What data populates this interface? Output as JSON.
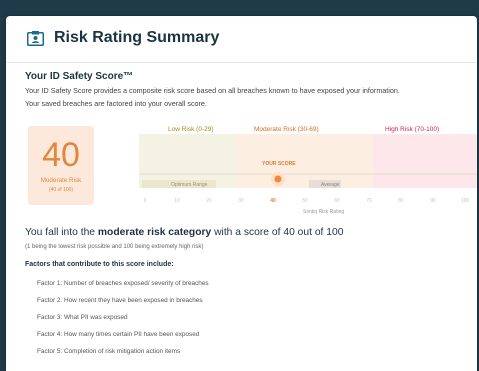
{
  "header": {
    "title": "Risk Rating Summary",
    "icon": "id-card-icon"
  },
  "summary": {
    "heading": "Your ID Safety Score™",
    "description_line1": "Your ID Safety Score provides a composite risk score based on all breaches known to have exposed your information.",
    "description_line2": "Your saved breaches are factored into your overall score."
  },
  "score": {
    "value": "40",
    "label": "Moderate Risk",
    "sublabel": "(40 of 100)"
  },
  "risk_ranges": {
    "low": "Low Risk (0-29)",
    "moderate": "Moderate Risk (30-69)",
    "high": "High Risk (70-100)"
  },
  "gauge": {
    "optimum_label": "Optimum Range",
    "average_label": "Average",
    "your_score_label": "YOUR SCORE",
    "axis_label": "Sontiq Risk Rating",
    "ticks": [
      "0",
      "10",
      "20",
      "30",
      "40",
      "50",
      "60",
      "70",
      "80",
      "90",
      "100"
    ],
    "score_value": 40,
    "colors": {
      "low": "#f4f2e3",
      "moderate": "#fcefe2",
      "high": "#fde7ea",
      "marker": "#ef8a3f"
    }
  },
  "category": {
    "prefix": "You fall into the ",
    "bold": "moderate risk category",
    "suffix": " with a score of 40 out of 100",
    "note": "(1 being the lowest risk possible and 100 being extremely high risk)"
  },
  "factors": {
    "title": "Factors that contribute to this score include:",
    "items": [
      "Factor 1: Number of breaches exposed/ severity of breaches",
      "Factor 2: How recent they have been exposed in breaches",
      "Factor 3: What PII was exposed",
      "Factor 4:  How many times certain PII have been exposed",
      "Factor 5: Completion of risk mitigation action items"
    ]
  }
}
